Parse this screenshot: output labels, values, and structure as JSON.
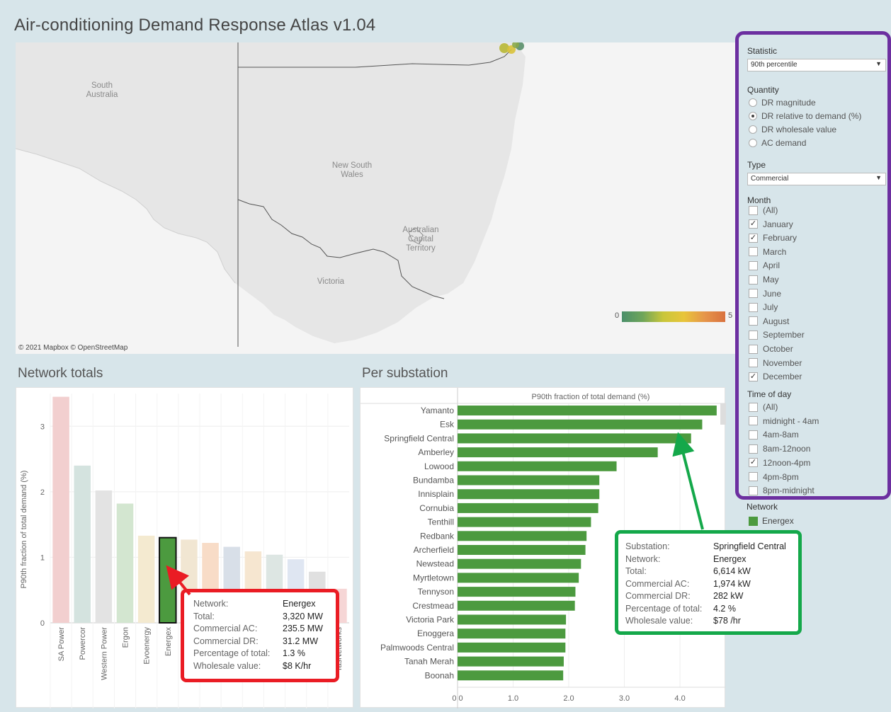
{
  "app": {
    "title": "Air-conditioning Demand Response Atlas v1.04"
  },
  "map": {
    "regions": [
      "South Australia",
      "New South Wales",
      "Australian Capital Territory",
      "Victoria"
    ],
    "credit": "© 2021 Mapbox © OpenStreetMap",
    "legend": {
      "min": "0",
      "max": "5"
    }
  },
  "filters": {
    "statistic": {
      "label": "Statistic",
      "value": "90th percentile"
    },
    "quantity": {
      "label": "Quantity",
      "options": [
        {
          "label": "DR magnitude",
          "selected": false
        },
        {
          "label": "DR relative to demand (%)",
          "selected": true
        },
        {
          "label": "DR wholesale value",
          "selected": false
        },
        {
          "label": "AC demand",
          "selected": false
        }
      ]
    },
    "type": {
      "label": "Type",
      "value": "Commercial"
    },
    "month": {
      "label": "Month",
      "options": [
        {
          "label": "(All)",
          "checked": false
        },
        {
          "label": "January",
          "checked": true
        },
        {
          "label": "February",
          "checked": true
        },
        {
          "label": "March",
          "checked": false
        },
        {
          "label": "April",
          "checked": false
        },
        {
          "label": "May",
          "checked": false
        },
        {
          "label": "June",
          "checked": false
        },
        {
          "label": "July",
          "checked": false
        },
        {
          "label": "August",
          "checked": false
        },
        {
          "label": "September",
          "checked": false
        },
        {
          "label": "October",
          "checked": false
        },
        {
          "label": "November",
          "checked": false
        },
        {
          "label": "December",
          "checked": true
        }
      ]
    },
    "time_of_day": {
      "label": "Time of day",
      "options": [
        {
          "label": "(All)",
          "checked": false
        },
        {
          "label": "midnight - 4am",
          "checked": false
        },
        {
          "label": "4am-8am",
          "checked": false
        },
        {
          "label": "8am-12noon",
          "checked": false
        },
        {
          "label": "12noon-4pm",
          "checked": true
        },
        {
          "label": "4pm-8pm",
          "checked": false
        },
        {
          "label": "8pm-midnight",
          "checked": false
        }
      ]
    },
    "network": {
      "label": "Network",
      "item": "Energex",
      "color": "#4c9a3f"
    }
  },
  "panels": {
    "network_totals": "Network totals",
    "per_substation": "Per substation"
  },
  "chart_data": [
    {
      "type": "bar",
      "title": "Network totals",
      "ylabel": "P90th fraction of total demand (%)",
      "ylim": [
        0,
        3.5
      ],
      "yticks": [
        "0",
        "1",
        "2",
        "3"
      ],
      "categories": [
        "SA Power",
        "Powercor",
        "Western Power",
        "Ergon",
        "Evoenergy",
        "Energex",
        "",
        "",
        "",
        "",
        "",
        "",
        "",
        "TasNetworks"
      ],
      "visible_labels": [
        "SA Power",
        "Powercor",
        "Western Power",
        "Ergon",
        "Evoenergy",
        "Energex",
        "TasNetworks"
      ],
      "values": [
        3.45,
        2.4,
        2.02,
        1.82,
        1.33,
        1.3,
        1.27,
        1.22,
        1.16,
        1.09,
        1.04,
        0.97,
        0.78,
        0.52
      ],
      "colors": [
        "#f2cfcf",
        "#d4e3df",
        "#e3e3e3",
        "#d3e6d0",
        "#f4ead0",
        "#4c9a3f",
        "#f1e6d2",
        "#f8dcc7",
        "#d8dfe8",
        "#f6e6d0",
        "#dde6e3",
        "#dfe6f2",
        "#e0e0e0",
        "#f6d6d6"
      ],
      "highlight": "Energex"
    },
    {
      "type": "bar",
      "orientation": "horizontal",
      "title": "P90th fraction of total demand (%)",
      "xlim": [
        0,
        4.7
      ],
      "xticks": [
        "0.0",
        "1.0",
        "2.0",
        "3.0",
        "4.0"
      ],
      "categories": [
        "Yamanto",
        "Esk",
        "Springfield Central",
        "Amberley",
        "Lowood",
        "Bundamba",
        "Innisplain",
        "Cornubia",
        "Tenthill",
        "Redbank",
        "Archerfield",
        "Newstead",
        "Myrtletown",
        "Tennyson",
        "Crestmead",
        "Victoria Park",
        "Enoggera",
        "Palmwoods Central",
        "Tanah Merah",
        "Boonah"
      ],
      "values": [
        4.66,
        4.4,
        4.2,
        3.6,
        2.86,
        2.55,
        2.55,
        2.53,
        2.4,
        2.32,
        2.3,
        2.22,
        2.18,
        2.12,
        2.11,
        1.95,
        1.94,
        1.94,
        1.91,
        1.9
      ],
      "color": "#4c9a3f"
    }
  ],
  "tooltips": {
    "network": {
      "rows": [
        {
          "k": "Network:",
          "v": "Energex"
        },
        {
          "k": "Total:",
          "v": "3,320 MW"
        },
        {
          "k": "Commercial AC:",
          "v": "235.5 MW"
        },
        {
          "k": "Commercial DR:",
          "v": "31.2 MW"
        },
        {
          "k": "Percentage of total:",
          "v": "1.3 %"
        },
        {
          "k": "Wholesale value:",
          "v": "$8 K/hr"
        }
      ]
    },
    "substation": {
      "rows": [
        {
          "k": "Substation:",
          "v": "Springfield Central"
        },
        {
          "k": "Network:",
          "v": "Energex"
        },
        {
          "k": "Total:",
          "v": "6,614 kW"
        },
        {
          "k": "Commercial AC:",
          "v": "1,974 kW"
        },
        {
          "k": "Commercial DR:",
          "v": "282 kW"
        },
        {
          "k": "Percentage of total:",
          "v": "4.2 %"
        },
        {
          "k": "Wholesale value:",
          "v": "$78 /hr"
        }
      ]
    }
  }
}
